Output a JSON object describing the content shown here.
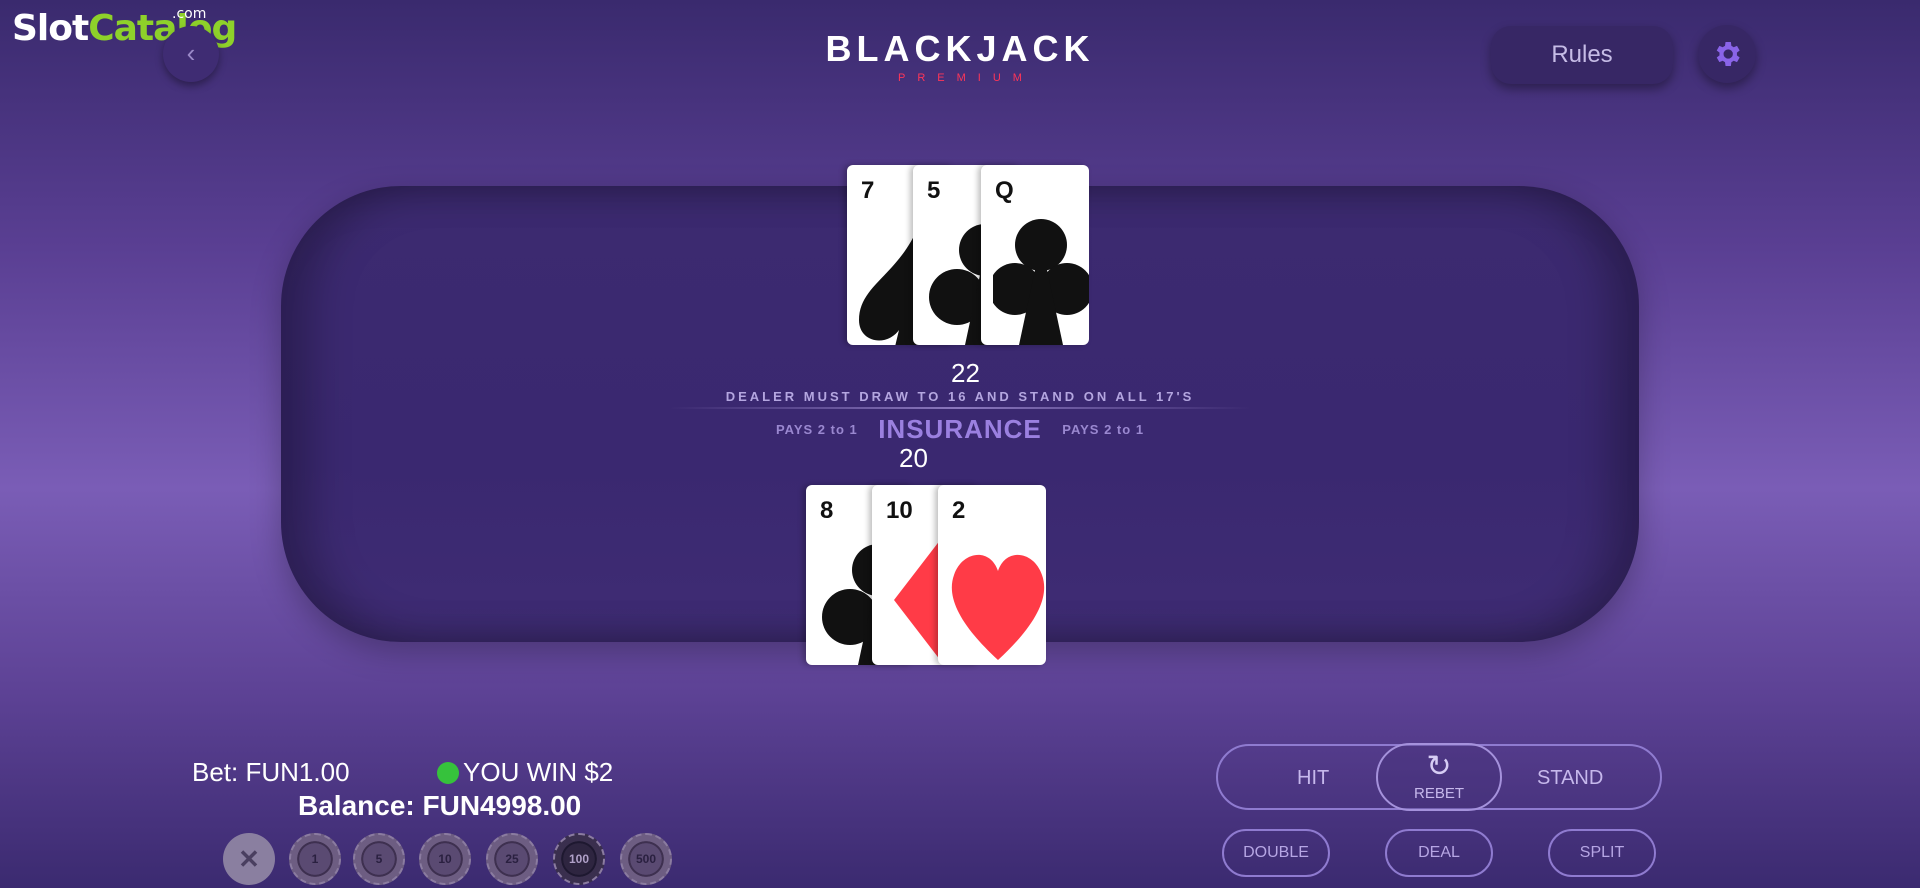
{
  "watermark": {
    "part1": "Slot",
    "part2": "Catalog",
    "domain": ".com"
  },
  "header": {
    "back_icon": "chevron-left-icon",
    "title": "BLACKJACK",
    "subtitle": "PREMIUM",
    "rules_label": "Rules",
    "settings_icon": "gear-icon"
  },
  "dealer": {
    "score": "22",
    "cards": [
      {
        "rank": "7",
        "suit": "spade",
        "color": "#111111"
      },
      {
        "rank": "5",
        "suit": "club",
        "color": "#111111"
      },
      {
        "rank": "Q",
        "suit": "club",
        "color": "#111111"
      }
    ]
  },
  "table_text": {
    "rule": "DEALER MUST DRAW TO 16 AND STAND ON ALL 17'S",
    "pays_left": "PAYS 2  to 1",
    "insurance": "INSURANCE",
    "pays_right": "PAYS 2  to 1"
  },
  "player": {
    "score": "20",
    "cards": [
      {
        "rank": "8",
        "suit": "club",
        "color": "#111111"
      },
      {
        "rank": "10",
        "suit": "diamond",
        "color": "#ff3b47"
      },
      {
        "rank": "2",
        "suit": "heart",
        "color": "#ff3b47"
      }
    ]
  },
  "status": {
    "bet_label": "Bet:",
    "bet_value": "FUN1.00",
    "win_text": "YOU WIN $2",
    "balance_label": "Balance:",
    "balance_value": "FUN4998.00"
  },
  "chips": [
    {
      "label": "✕",
      "kind": "clear-bet"
    },
    {
      "label": "1"
    },
    {
      "label": "5"
    },
    {
      "label": "10"
    },
    {
      "label": "25"
    },
    {
      "label": "100"
    },
    {
      "label": "500"
    }
  ],
  "actions": {
    "hit": "HIT",
    "rebet": "REBET",
    "rebet_icon": "refresh-icon",
    "stand": "STAND",
    "double": "DOUBLE",
    "deal": "DEAL",
    "split": "SPLIT"
  },
  "colors": {
    "accent": "#8f7bd0",
    "win": "#36c23c",
    "logo_sub": "#ff3558"
  }
}
